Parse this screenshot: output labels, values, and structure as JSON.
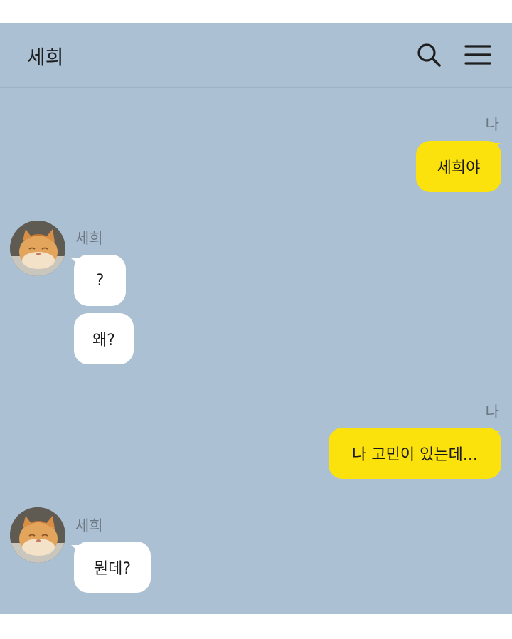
{
  "header": {
    "title": "세희",
    "search_icon": "search-icon",
    "menu_icon": "menu-icon"
  },
  "messages": [
    {
      "sender": "나",
      "text": "세희야",
      "side": "right"
    },
    {
      "sender": "세희",
      "text": "?",
      "side": "left"
    },
    {
      "sender": "세희",
      "text": "왜?",
      "side": "left"
    },
    {
      "sender": "나",
      "text": "나 고민이 있는데...",
      "side": "right"
    },
    {
      "sender": "세희",
      "text": "뭔데?",
      "side": "left"
    }
  ],
  "colors": {
    "background": "#abc0d3",
    "my_bubble": "#fbe20c",
    "other_bubble": "#ffffff"
  }
}
